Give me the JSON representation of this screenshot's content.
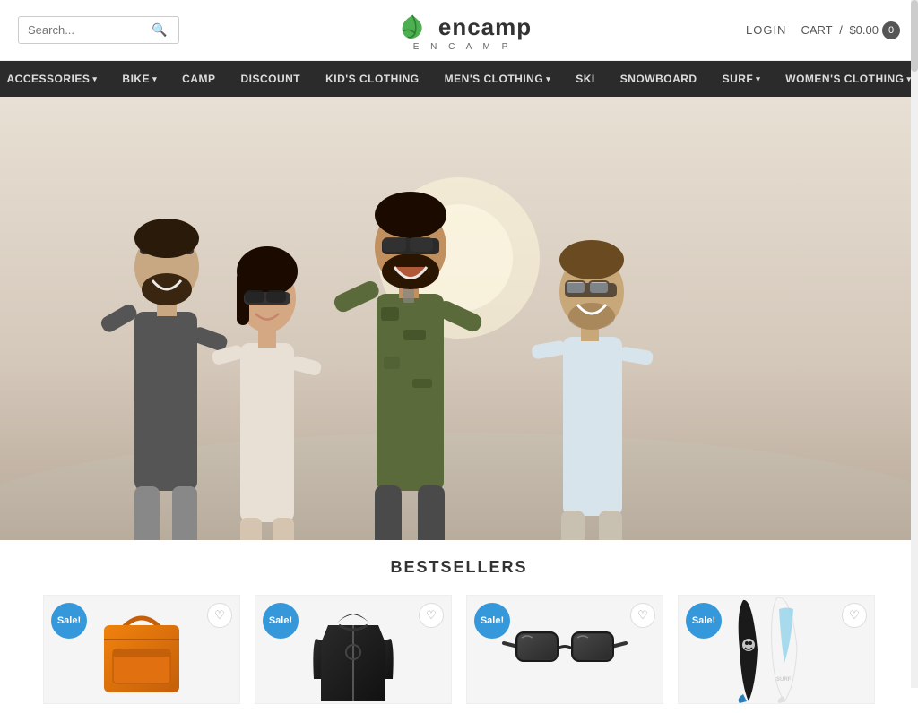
{
  "header": {
    "search_placeholder": "Search...",
    "search_label": "Search",
    "login_label": "LOGIN",
    "cart_label": "CART",
    "cart_separator": "/",
    "cart_price": "$0.00",
    "cart_count": "0",
    "logo_main": "encamp",
    "logo_sub": "E N C A M P",
    "logo_icon_alt": "encamp leaf logo"
  },
  "nav": {
    "items": [
      {
        "label": "ACCESSORIES",
        "has_dropdown": true
      },
      {
        "label": "BIKE",
        "has_dropdown": true
      },
      {
        "label": "CAMP",
        "has_dropdown": false
      },
      {
        "label": "DISCOUNT",
        "has_dropdown": false
      },
      {
        "label": "KID'S CLOTHING",
        "has_dropdown": false
      },
      {
        "label": "MEN'S CLOTHING",
        "has_dropdown": true
      },
      {
        "label": "SKI",
        "has_dropdown": false
      },
      {
        "label": "SNOWBOARD",
        "has_dropdown": false
      },
      {
        "label": "SURF",
        "has_dropdown": true
      },
      {
        "label": "WOMEN'S CLOTHING",
        "has_dropdown": true
      }
    ]
  },
  "bestsellers": {
    "title": "BESTSELLERS",
    "products": [
      {
        "id": 1,
        "sale": true,
        "sale_label": "Sale!",
        "color": "orange-bag",
        "wishlist": true
      },
      {
        "id": 2,
        "sale": true,
        "sale_label": "Sale!",
        "color": "black-jacket",
        "wishlist": true
      },
      {
        "id": 3,
        "sale": true,
        "sale_label": "Sale!",
        "color": "sunglasses",
        "wishlist": true
      },
      {
        "id": 4,
        "sale": true,
        "sale_label": "Sale!",
        "color": "surfboard",
        "wishlist": true
      }
    ]
  },
  "icons": {
    "search": "🔍",
    "heart": "♡",
    "chevron_down": "▾"
  }
}
